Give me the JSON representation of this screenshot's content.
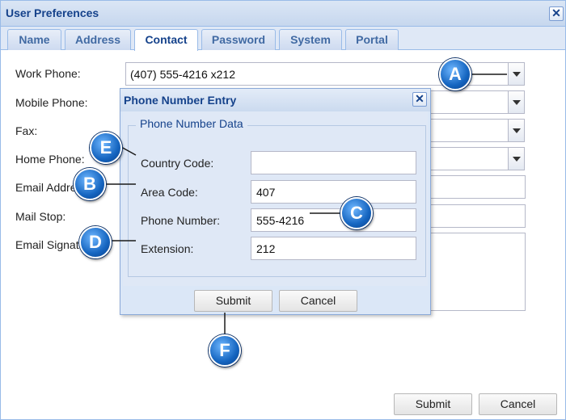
{
  "window": {
    "title": "User Preferences",
    "close_glyph": "✕"
  },
  "tabs": [
    {
      "label": "Name"
    },
    {
      "label": "Address"
    },
    {
      "label": "Contact",
      "active": true
    },
    {
      "label": "Password"
    },
    {
      "label": "System"
    },
    {
      "label": "Portal"
    }
  ],
  "form": {
    "work_phone_label": "Work Phone:",
    "work_phone_value": "(407) 555-4216 x212",
    "mobile_phone_label": "Mobile Phone:",
    "fax_label": "Fax:",
    "home_phone_label": "Home Phone:",
    "email_address_label": "Email Address:",
    "mail_stop_label": "Mail Stop:",
    "email_signature_label": "Email Signature:"
  },
  "footer": {
    "submit_label": "Submit",
    "cancel_label": "Cancel"
  },
  "dialog": {
    "title": "Phone Number Entry",
    "close_glyph": "✕",
    "legend": "Phone Number Data",
    "country_code_label": "Country Code:",
    "country_code_value": "",
    "area_code_label": "Area Code:",
    "area_code_value": "407",
    "phone_number_label": "Phone Number:",
    "phone_number_value": "555-4216",
    "extension_label": "Extension:",
    "extension_value": "212",
    "submit_label": "Submit",
    "cancel_label": "Cancel"
  },
  "callouts": {
    "a": "A",
    "b": "B",
    "c": "C",
    "d": "D",
    "e": "E",
    "f": "F"
  },
  "colors": {
    "header_text": "#15428b",
    "callout_blue": "#1565c0",
    "border_blue": "#99bbe8"
  }
}
